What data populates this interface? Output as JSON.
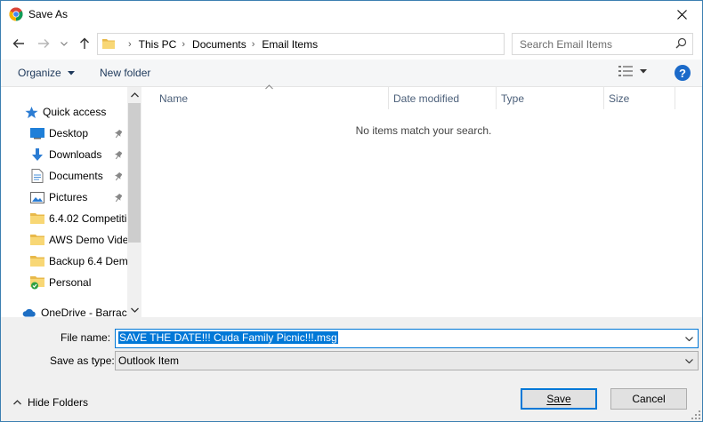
{
  "window": {
    "title": "Save As"
  },
  "address": {
    "crumbs": [
      "This PC",
      "Documents",
      "Email Items"
    ]
  },
  "search": {
    "placeholder": "Search Email Items"
  },
  "toolbar": {
    "organize_label": "Organize",
    "new_folder_label": "New folder",
    "help_label": "?"
  },
  "nav": {
    "quick_access": "Quick access",
    "items": [
      {
        "label": "Desktop",
        "icon": "desktop-icon",
        "pinned": true
      },
      {
        "label": "Downloads",
        "icon": "download-icon",
        "pinned": true
      },
      {
        "label": "Documents",
        "icon": "documents-icon",
        "pinned": true
      },
      {
        "label": "Pictures",
        "icon": "pictures-icon",
        "pinned": true
      },
      {
        "label": "6.4.02 Competiti",
        "icon": "folder-icon",
        "pinned": false
      },
      {
        "label": "AWS Demo Vide",
        "icon": "folder-icon",
        "pinned": false
      },
      {
        "label": "Backup 6.4 Dem",
        "icon": "folder-icon",
        "pinned": false
      },
      {
        "label": "Personal",
        "icon": "folder-sync-icon",
        "pinned": false
      }
    ],
    "onedrive": "OneDrive - Barrac"
  },
  "files": {
    "columns": [
      "Name",
      "Date modified",
      "Type",
      "Size"
    ],
    "empty_message": "No items match your search."
  },
  "form": {
    "file_name_label": "File name:",
    "file_name_value": "SAVE THE DATE!!! Cuda Family Picnic!!!.msg",
    "save_as_type_label": "Save as type:",
    "save_as_type_value": "Outlook Item"
  },
  "footer": {
    "hide_folders_label": "Hide Folders",
    "save_label": "Save",
    "cancel_label": "Cancel"
  },
  "colors": {
    "accent": "#0078d7",
    "help": "#1b6ac9",
    "folder": "#f8d775"
  }
}
